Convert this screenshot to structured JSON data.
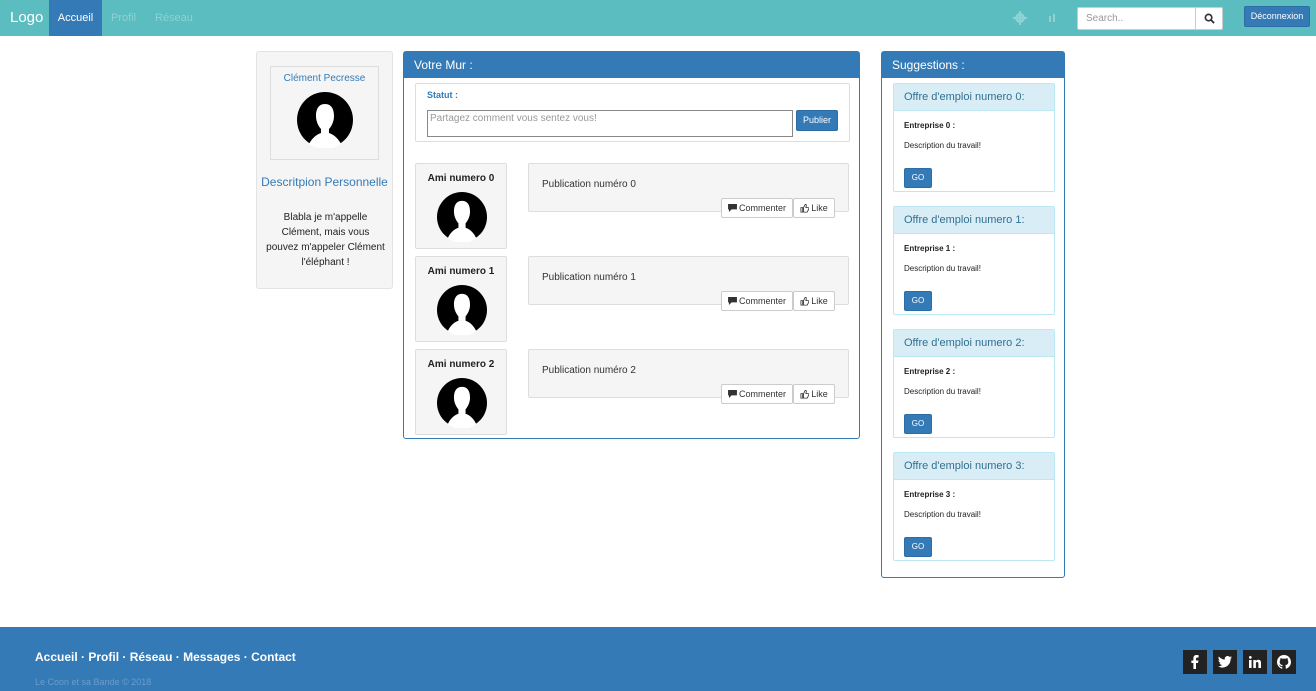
{
  "navbar": {
    "brand": "Logo",
    "items": [
      {
        "label": "Accueil",
        "active": true
      },
      {
        "label": "Profil",
        "active": false
      },
      {
        "label": "Réseau",
        "active": false
      }
    ],
    "search_placeholder": "Search..",
    "logout_label": "Déconnexion"
  },
  "profile": {
    "name": "Clément Pecresse",
    "desc_title": "Descritpion Personnelle",
    "desc_text": "Blabla je m'appelle Clément, mais vous pouvez m'appeler Clément l'éléphant !"
  },
  "wall": {
    "title": "Votre Mur :",
    "status_label": "Statut :",
    "status_placeholder": "Partagez comment vous sentez vous!",
    "publish_label": "Publier",
    "posts": [
      {
        "friend": "Ami numero 0",
        "text": "Publication numéro 0"
      },
      {
        "friend": "Ami numero 1",
        "text": "Publication numéro 1"
      },
      {
        "friend": "Ami numero 2",
        "text": "Publication numéro 2"
      }
    ],
    "comment_label": "Commenter",
    "like_label": "Like"
  },
  "suggestions": {
    "title": "Suggestions :",
    "offers": [
      {
        "title": "Offre d'emploi numero 0:",
        "company": "Entreprise 0 :",
        "description": "Description du travail!",
        "button": "GO"
      },
      {
        "title": "Offre d'emploi numero 1:",
        "company": "Entreprise 1 :",
        "description": "Description du travail!",
        "button": "GO"
      },
      {
        "title": "Offre d'emploi numero 2:",
        "company": "Entreprise 2 :",
        "description": "Description du travail!",
        "button": "GO"
      },
      {
        "title": "Offre d'emploi numero 3:",
        "company": "Entreprise 3 :",
        "description": "Description du travail!",
        "button": "GO"
      }
    ]
  },
  "footer": {
    "links": [
      "Accueil",
      "Profil",
      "Réseau",
      "Messages",
      "Contact"
    ],
    "copyright": "Le Coon et sa Bande © 2018",
    "social_icons": [
      "facebook-icon",
      "twitter-icon",
      "linkedin-icon",
      "github-icon"
    ]
  },
  "colors": {
    "navbar": "#5bbdbf",
    "primary": "#337ab7",
    "panel_info": "#d9edf7"
  }
}
